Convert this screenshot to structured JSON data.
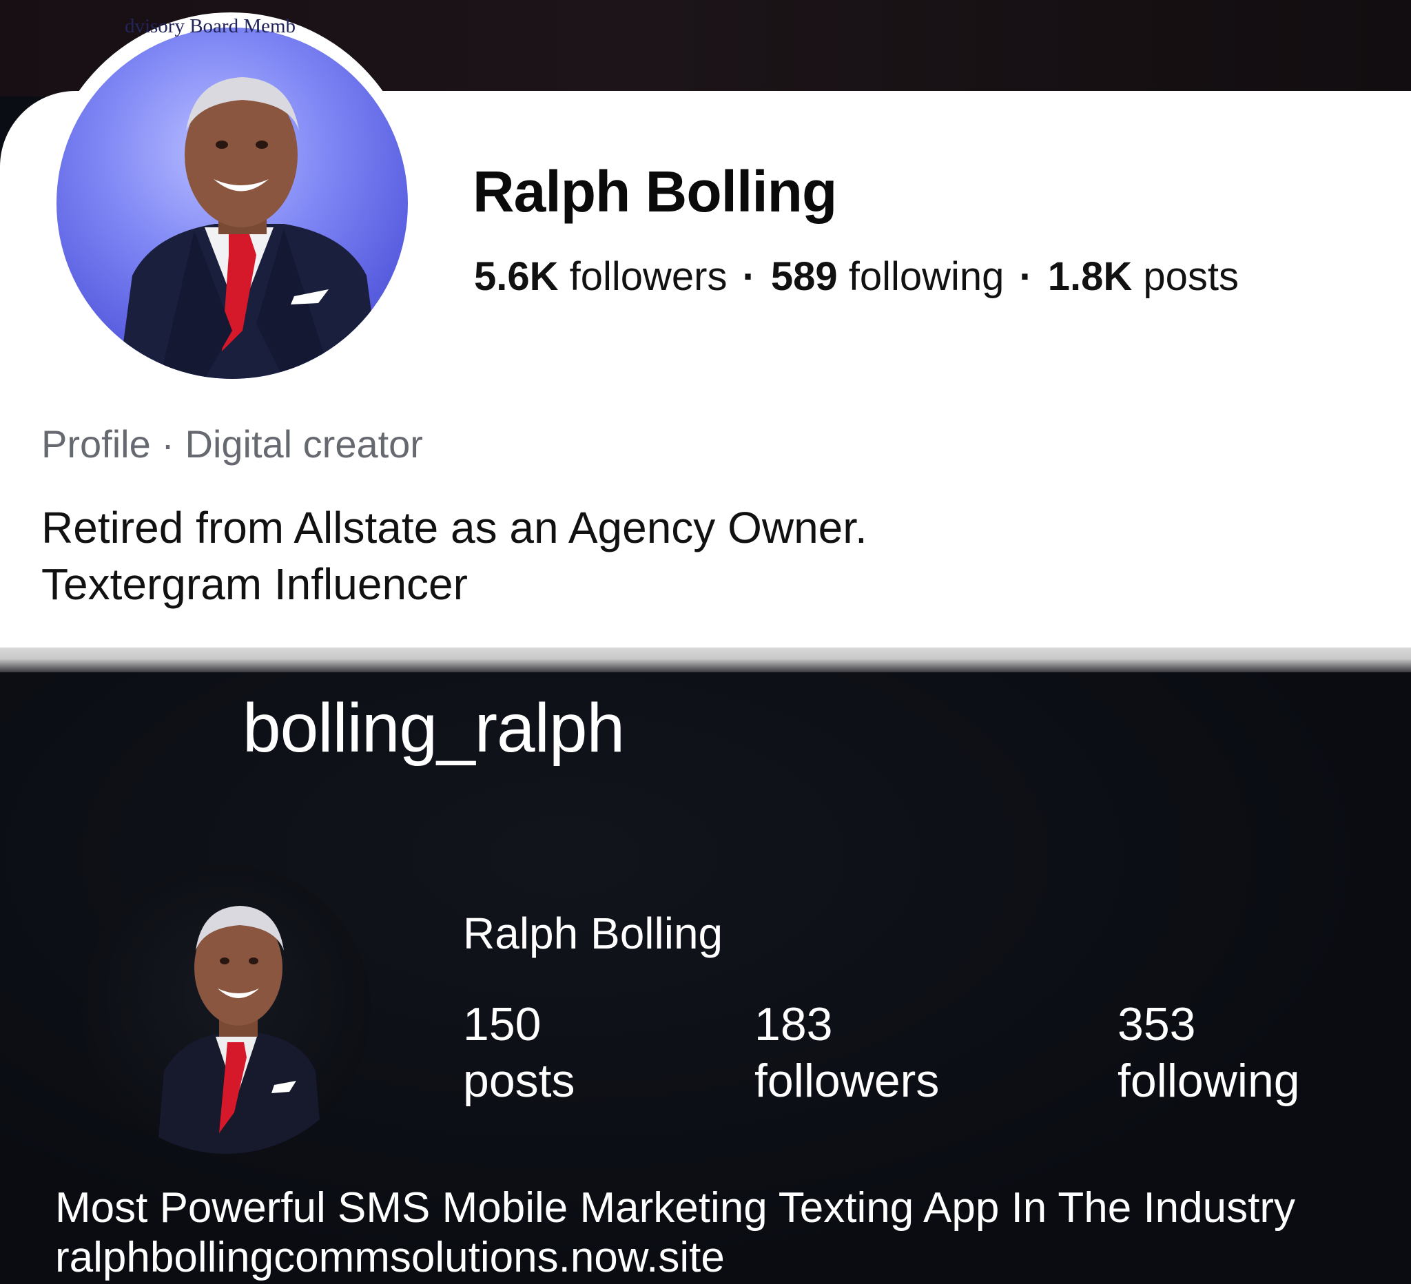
{
  "facebook_profile": {
    "avatar_caption": "dvisory Board Memb",
    "name": "Ralph Bolling",
    "stats": {
      "followers_count": "5.6K",
      "followers_label": "followers",
      "following_count": "589",
      "following_label": "following",
      "posts_count": "1.8K",
      "posts_label": "posts",
      "separator": "·"
    },
    "category": "Profile · Digital creator",
    "bio_lines": [
      "Retired from Allstate as an Agency Owner.",
      "Textergram Influencer"
    ]
  },
  "instagram_profile": {
    "username": "bolling_ralph",
    "name": "Ralph Bolling",
    "stats": [
      {
        "count": "150",
        "label": "posts"
      },
      {
        "count": "183",
        "label": "followers"
      },
      {
        "count": "353",
        "label": "following"
      }
    ],
    "bio_lines": [
      "Most Powerful SMS Mobile Marketing Texting App In The Industry",
      "ralphbollingcommsolutions.now.site"
    ]
  }
}
